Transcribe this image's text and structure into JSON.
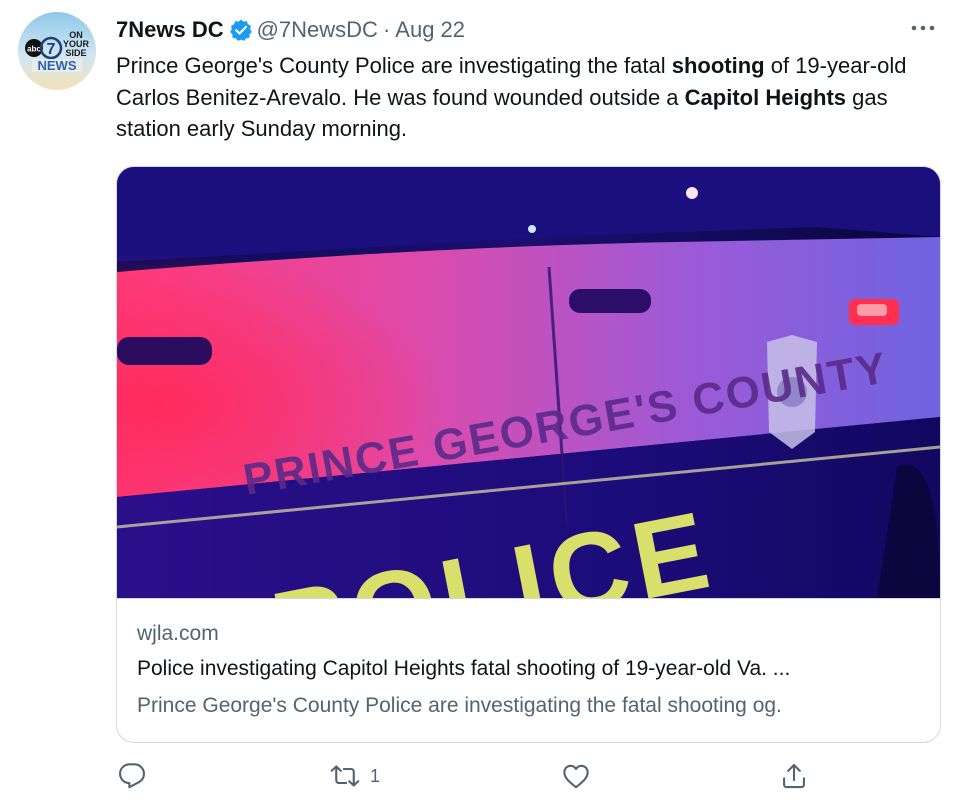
{
  "tweet": {
    "author": {
      "display_name": "7News DC",
      "handle": "@7NewsDC",
      "verified": true,
      "avatar_text": {
        "network": "abc",
        "channel": "7",
        "slogan_lines": [
          "ON",
          "YOUR",
          "SIDE"
        ],
        "brand": "NEWS"
      }
    },
    "separator": "·",
    "date": "Aug 22",
    "more_icon": "more-horizontal-icon",
    "text_segments": [
      {
        "text": "Prince George's County Police are investigating the fatal ",
        "bold": false
      },
      {
        "text": "shooting",
        "bold": true
      },
      {
        "text": " of 19-year-old Carlos Benitez-Arevalo. He was found wounded outside a ",
        "bold": false
      },
      {
        "text": "Capitol Heights",
        "bold": true
      },
      {
        "text": " gas station early Sunday morning.",
        "bold": false
      }
    ],
    "card": {
      "image_text": {
        "door_lettering": "PRINCE GEORGE'S COUNTY",
        "side_lettering": "POLICE"
      },
      "domain": "wjla.com",
      "title": "Police investigating Capitol Heights fatal shooting of 19-year-old Va. ...",
      "description": "Prince George's County Police are investigating the fatal shooting og."
    },
    "actions": {
      "reply": {
        "icon": "reply-icon",
        "count": ""
      },
      "retweet": {
        "icon": "retweet-icon",
        "count": "1"
      },
      "like": {
        "icon": "heart-icon",
        "count": ""
      },
      "share": {
        "icon": "share-icon",
        "count": ""
      }
    }
  },
  "colors": {
    "text_primary": "#0f1419",
    "text_secondary": "#536471",
    "verified_blue": "#1d9bf0",
    "border": "#cfd9de"
  }
}
